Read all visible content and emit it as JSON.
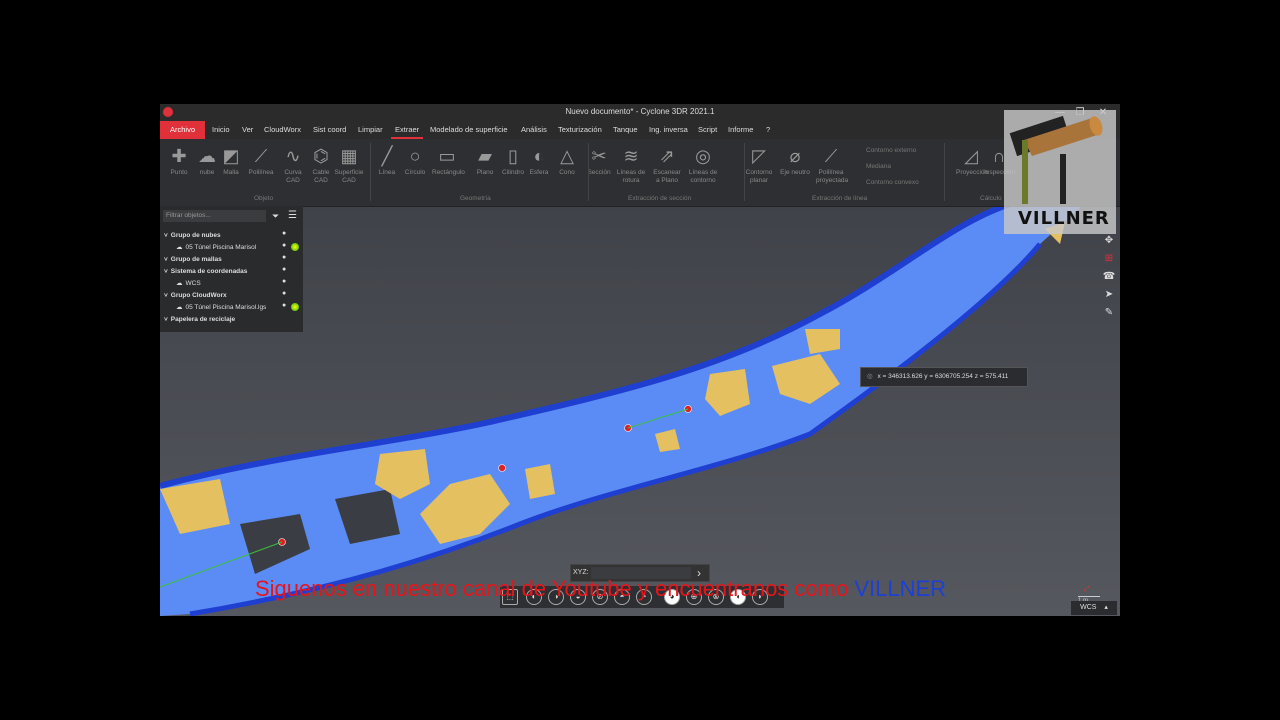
{
  "window": {
    "title": "Nuevo documento* - Cyclone 3DR 2021.1",
    "minimize": "—",
    "maximize": "❐",
    "close": "✕"
  },
  "menu": [
    "Archivo",
    "Inicio",
    "Ver",
    "CloudWorx",
    "Sist coord",
    "Limpiar",
    "Extraer",
    "Modelado de superficie",
    "Análisis",
    "Texturización",
    "Tanque",
    "Ing. inversa",
    "Script",
    "Informe",
    "?"
  ],
  "ribbon": {
    "tools": [
      {
        "label": "Punto",
        "icon": "point-icon"
      },
      {
        "label": "nube",
        "icon": "cloud-icon"
      },
      {
        "label": "Malla",
        "icon": "mesh-icon"
      },
      {
        "label": "Polilínea",
        "icon": "polyline-icon"
      },
      {
        "label": "Curva CAD",
        "icon": "curve-icon"
      },
      {
        "label": "Cable CAD",
        "icon": "cable-icon"
      },
      {
        "label": "Superficie CAD",
        "icon": "surface-icon"
      },
      {
        "label": "Línea",
        "icon": "line-icon"
      },
      {
        "label": "Círculo",
        "icon": "circle-icon"
      },
      {
        "label": "Rectángulo",
        "icon": "rectangle-icon"
      },
      {
        "label": "Plano",
        "icon": "plane-icon"
      },
      {
        "label": "Cilindro",
        "icon": "cylinder-icon"
      },
      {
        "label": "Esfera",
        "icon": "sphere-icon"
      },
      {
        "label": "Cono",
        "icon": "cone-icon"
      },
      {
        "label": "Sección",
        "icon": "section-icon"
      },
      {
        "label": "Líneas de rotura",
        "icon": "breaklines-icon"
      },
      {
        "label": "Escanear a Plano",
        "icon": "scan-to-plane-icon"
      },
      {
        "label": "Líneas de contorno",
        "icon": "contour-icon"
      },
      {
        "label": "Contorno planar",
        "icon": "planar-contour-icon"
      },
      {
        "label": "Eje neutro",
        "icon": "neutral-axis-icon"
      },
      {
        "label": "Polilínea proyectada",
        "icon": "projected-polyline-icon"
      },
      {
        "label": "Proyección",
        "icon": "projection-icon"
      },
      {
        "label": "Inspección",
        "icon": "inspection-icon"
      }
    ],
    "small_tools": [
      "Contorno externo",
      "Mediana",
      "Contorno convexo"
    ],
    "groups": [
      "Objeto",
      "Geometría",
      "Extracción de sección",
      "Extracción de línea",
      "Cálculo"
    ]
  },
  "tree": {
    "filter_placeholder": "Filtrar objetos...",
    "rows": [
      {
        "label": "Grupo de nubes",
        "bold": true
      },
      {
        "label": "05 Túnel Piscina Marisol",
        "bold": false
      },
      {
        "label": "Grupo de mallas",
        "bold": true
      },
      {
        "label": "Sistema de coordenadas",
        "bold": true
      },
      {
        "label": "WCS",
        "bold": false
      },
      {
        "label": "Grupo CloudWorx",
        "bold": true
      },
      {
        "label": "05 Túnel Piscina Marisol.lgs",
        "bold": false
      },
      {
        "label": "Papelera de reciclaje",
        "bold": true
      }
    ]
  },
  "viewport": {
    "coord_readout": "x = 346313.626  y = 6306705.254  z = 575.411",
    "xyz_label": "XYZ:",
    "xyz_go": "›",
    "wcs_label": "WCS",
    "scale_label": "1 m"
  },
  "watermark": {
    "brand": "VILLNER"
  },
  "overlay": {
    "text": "Siguenos en nuestro canal de Youtube y encuentranos como ",
    "brand": "VILLNER",
    "text_color": "#e8141a",
    "brand_color": "#1d3fd6"
  },
  "colors": {
    "accent": "#e0303a",
    "tunnel": "#5b8cf5",
    "deposits": "#e5c060"
  }
}
